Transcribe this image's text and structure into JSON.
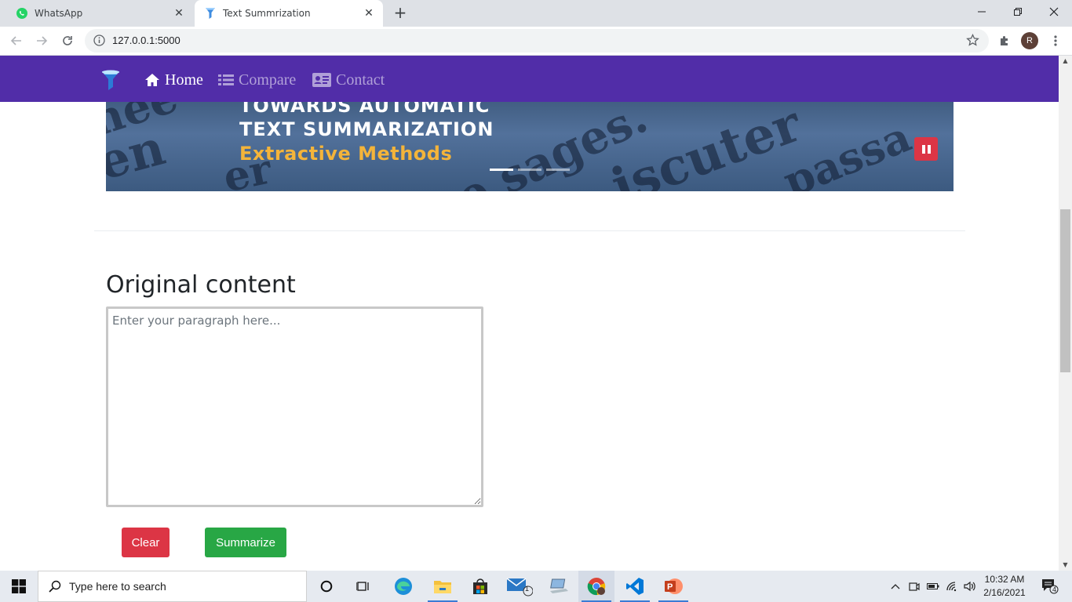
{
  "browser": {
    "tabs": [
      {
        "title": "WhatsApp",
        "icon": "whatsapp-icon",
        "active": false
      },
      {
        "title": "Text Summrization",
        "icon": "funnel-favicon",
        "active": true
      }
    ],
    "url": "127.0.0.1:5000",
    "profile_initial": "R"
  },
  "navbar": {
    "items": [
      {
        "label": "Home",
        "icon": "home-icon",
        "active": true
      },
      {
        "label": "Compare",
        "icon": "list-icon",
        "active": false
      },
      {
        "label": "Contact",
        "icon": "id-card-icon",
        "active": false
      }
    ]
  },
  "banner": {
    "line1": "TOWARDS AUTOMATIC",
    "line2": "TEXT SUMMARIZATION",
    "line3": "Extractive Methods",
    "slides": 3,
    "active_slide": 1
  },
  "main": {
    "heading": "Original content",
    "textarea_placeholder": "Enter your paragraph here...",
    "clear_label": "Clear",
    "summarize_label": "Summarize"
  },
  "taskbar": {
    "search_placeholder": "Type here to search",
    "mail_badge": "1",
    "time": "10:32 AM",
    "date": "2/16/2021",
    "notifications": "4"
  },
  "colors": {
    "navbar": "#512da8",
    "danger": "#dc3545",
    "success": "#28a745",
    "banner_accent": "#f4b43a"
  }
}
